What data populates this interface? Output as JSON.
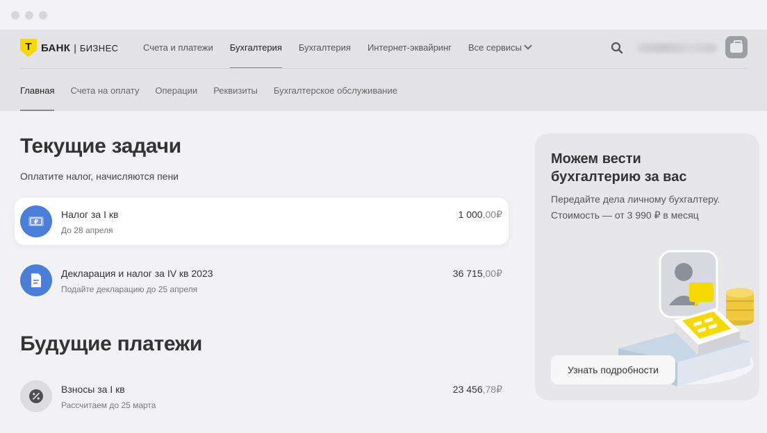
{
  "header": {
    "logo": {
      "letter": "Т",
      "bank": "БАНК",
      "separator": "|",
      "business": "БИЗНЕС"
    },
    "nav": [
      {
        "label": "Счета и платежи",
        "active": false
      },
      {
        "label": "Бухгалтерия",
        "active": true
      },
      {
        "label": "Бухгалтерия",
        "active": false
      },
      {
        "label": "Интернет-эквайринг",
        "active": false
      },
      {
        "label": "Все сервисы",
        "active": false
      }
    ],
    "user_name_blurred": "",
    "icons": {
      "search": "search-icon",
      "avatar": "briefcase-icon",
      "dropdown": "chevron-down-icon"
    }
  },
  "subnav": [
    {
      "label": "Главная",
      "active": true
    },
    {
      "label": "Счета на оплату",
      "active": false
    },
    {
      "label": "Операции",
      "active": false
    },
    {
      "label": "Реквизиты",
      "active": false
    },
    {
      "label": "Бухгалтерское обслуживание",
      "active": false
    }
  ],
  "current_tasks": {
    "title": "Текущие задачи",
    "hint": "Оплатите налог, начисляются пени",
    "items": [
      {
        "title": "Налог за I кв",
        "subtitle": "До 28 апреля",
        "amount_int": "1 000",
        "amount_frac": ",00",
        "currency": "₽",
        "icon": "ruble-banknote-icon"
      },
      {
        "title": "Декларация и налог за IV кв 2023",
        "subtitle": "Подайте декларацию до 25 апреля",
        "amount_int": "36 715",
        "amount_frac": ",00",
        "currency": "₽",
        "icon": "document-icon"
      }
    ]
  },
  "future_payments": {
    "title": "Будущие платежи",
    "items": [
      {
        "title": "Взносы за I кв",
        "subtitle": "Рассчитаем до 25 марта",
        "amount_int": "23 456",
        "amount_frac": ",78",
        "currency": "₽",
        "icon": "percent-icon"
      }
    ]
  },
  "promo": {
    "title": "Можем вести бухгалтерию за вас",
    "text": "Передайте дела личному бухгалтеру. Стоимость — от 3 990 ₽ в месяц",
    "button": "Узнать подробности",
    "illustration": "accountant-illustration"
  },
  "colors": {
    "accent_yellow": "#f5d900",
    "icon_blue": "#4b7ed8",
    "background": "#f2f2f4",
    "header_bg": "#e3e3e5"
  }
}
